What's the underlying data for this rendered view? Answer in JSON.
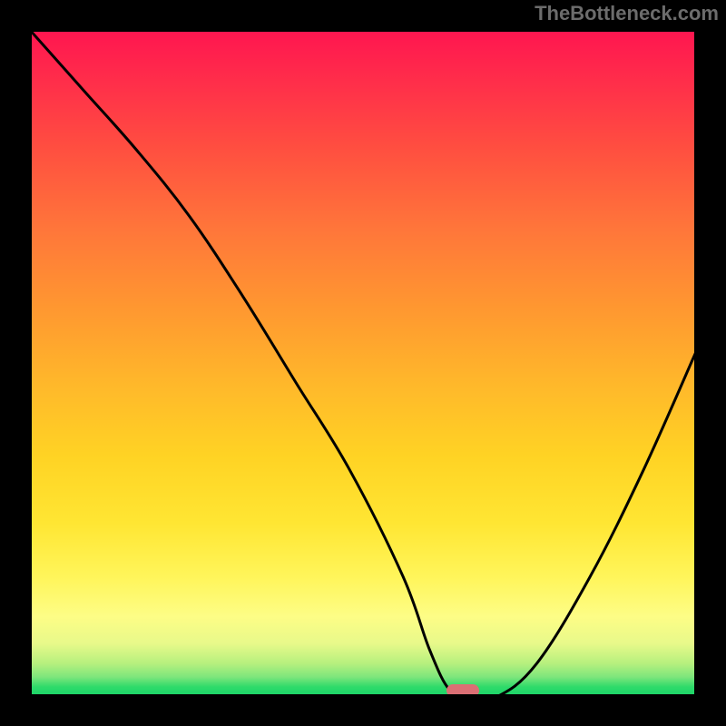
{
  "watermark": "TheBottleneck.com",
  "chart_data": {
    "type": "line",
    "title": "",
    "xlabel": "",
    "ylabel": "",
    "x_range": [
      0,
      100
    ],
    "y_range": [
      0,
      100
    ],
    "grid": false,
    "legend": false,
    "background_gradient": {
      "direction": "vertical",
      "stops": [
        {
          "pos": 0.0,
          "color": "#ff1550",
          "meaning": "high-bottleneck"
        },
        {
          "pos": 0.5,
          "color": "#ffba2a",
          "meaning": "mid"
        },
        {
          "pos": 0.9,
          "color": "#fdfd86",
          "meaning": "pale"
        },
        {
          "pos": 1.0,
          "color": "#18d268",
          "meaning": "no-bottleneck"
        }
      ]
    },
    "series": [
      {
        "name": "bottleneck-curve",
        "color": "#000000",
        "x": [
          0,
          8,
          16,
          24,
          32,
          40,
          48,
          56,
          60,
          63,
          66,
          70,
          76,
          84,
          92,
          100
        ],
        "values": [
          100,
          91,
          82,
          72,
          60,
          47,
          34,
          18,
          7,
          1,
          0,
          0,
          5,
          18,
          34,
          52
        ]
      }
    ],
    "marker": {
      "name": "optimal-point",
      "interactable": true,
      "x_center": 65,
      "y": 0,
      "color": "#db6f74"
    }
  }
}
